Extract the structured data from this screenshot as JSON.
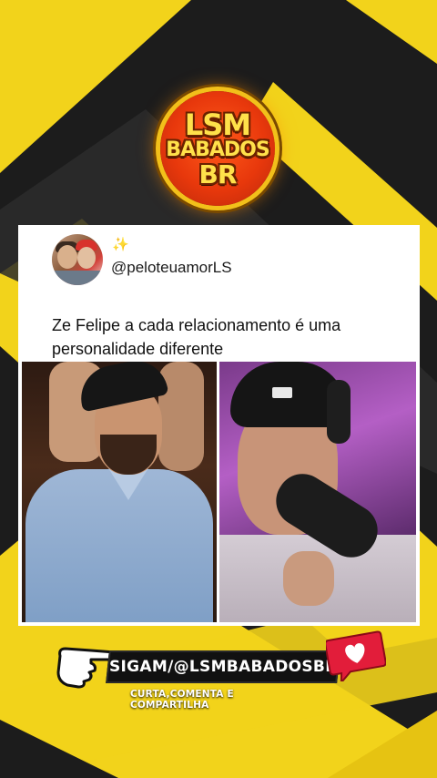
{
  "colors": {
    "brand_yellow": "#f2d31b",
    "dark_band": "#1c1c1c",
    "logo_red": "#e8380c",
    "logo_text": "#ffe14a",
    "heart_red": "#e21d3a"
  },
  "logo": {
    "line1": "LSM",
    "line2": "BABADOS",
    "line3": "BR"
  },
  "tweet": {
    "sparkle": "✨",
    "handle": "@peloteuamorLS",
    "text": "Ze Felipe a cada relacionamento é uma personalidade diferente"
  },
  "cta": {
    "follow": "SIGAM/@LSMBABADOSBR",
    "sub": "CURTA,COMENTA E COMPARTILHA"
  },
  "icons": {
    "pointer": "pointing-hand-icon",
    "heart": "heart-notification-icon"
  }
}
